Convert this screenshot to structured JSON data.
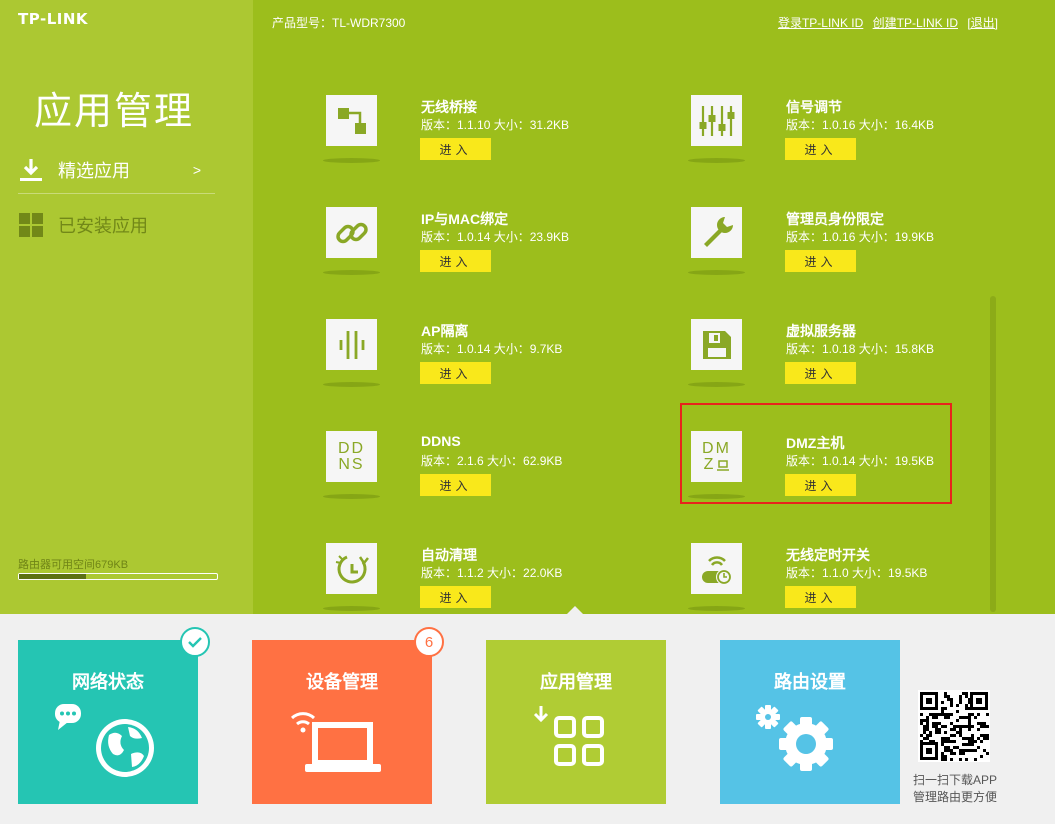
{
  "brand": "TP-LINK",
  "header": {
    "model_label": "产品型号：TL-WDR7300",
    "login_link": "登录TP-LINK ID",
    "create_link": "创建TP-LINK ID",
    "logout_link": "[退出]"
  },
  "sidebar": {
    "title": "应用管理",
    "items": [
      {
        "label": "精选应用",
        "arrow": ">",
        "icon": "download-icon"
      },
      {
        "label": "已安装应用",
        "icon": "grid-icon"
      }
    ],
    "storage_text": "路由器可用空间679KB",
    "storage_used_fraction": 0.34
  },
  "apps": [
    {
      "name": "无线桥接",
      "meta": "版本：1.1.10 大小：31.2KB",
      "enter": "进入",
      "icon": "bridge-icon"
    },
    {
      "name": "信号调节",
      "meta": "版本：1.0.16 大小：16.4KB",
      "enter": "进入",
      "icon": "sliders-icon"
    },
    {
      "name": "IP与MAC绑定",
      "meta": "版本：1.0.14 大小：23.9KB",
      "enter": "进入",
      "icon": "link-icon"
    },
    {
      "name": "管理员身份限定",
      "meta": "版本：1.0.16 大小：19.9KB",
      "enter": "进入",
      "icon": "wrench-icon"
    },
    {
      "name": "AP隔离",
      "meta": "版本：1.0.14 大小：9.7KB",
      "enter": "进入",
      "icon": "ap-isolation-icon"
    },
    {
      "name": "虚拟服务器",
      "meta": "版本：1.0.18 大小：15.8KB",
      "enter": "进入",
      "icon": "server-icon"
    },
    {
      "name": "DDNS",
      "meta": "版本：2.1.6 大小：62.9KB",
      "enter": "进入",
      "icon": "ddns-icon",
      "icon_text": [
        "DD",
        "NS"
      ]
    },
    {
      "name": "DMZ主机",
      "meta": "版本：1.0.14 大小：19.5KB",
      "enter": "进入",
      "icon": "dmz-icon",
      "icon_text": [
        "DM",
        "Z"
      ]
    },
    {
      "name": "自动清理",
      "meta": "版本：1.1.2 大小：22.0KB",
      "enter": "进入",
      "icon": "auto-clean-icon"
    },
    {
      "name": "无线定时开关",
      "meta": "版本：1.1.0 大小：19.5KB",
      "enter": "进入",
      "icon": "wifi-timer-icon"
    }
  ],
  "tiles": [
    {
      "label": "网络状态",
      "color": "#25c5b3",
      "icon": "globe-icon",
      "badge": "check-icon"
    },
    {
      "label": "设备管理",
      "color": "#ff7143",
      "icon": "laptop-icon",
      "badge": "6"
    },
    {
      "label": "应用管理",
      "color": "#b0cc34",
      "icon": "apps-grid-icon"
    },
    {
      "label": "路由设置",
      "color": "#55c3e6",
      "icon": "gears-icon"
    }
  ],
  "qr": {
    "line1": "扫一扫下载APP",
    "line2": "管理路由更方便"
  }
}
